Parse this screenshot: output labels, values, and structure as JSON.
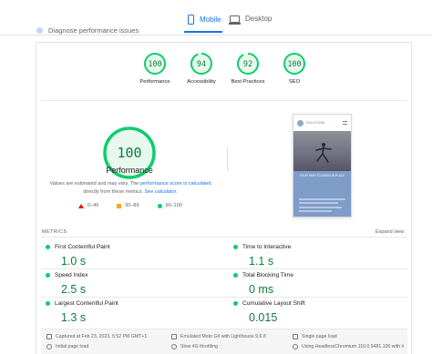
{
  "tabs": {
    "mobile": "Mobile",
    "desktop": "Desktop"
  },
  "diagnose_text": "Diagnose performance issues",
  "scores": [
    {
      "value": "100",
      "label": "Performance",
      "fraction": 1.0
    },
    {
      "value": "94",
      "label": "Accessibility",
      "fraction": 0.94
    },
    {
      "value": "92",
      "label": "Best Practices",
      "fraction": 0.92
    },
    {
      "value": "100",
      "label": "SEO",
      "fraction": 1.0
    }
  ],
  "main_score": {
    "value": "100",
    "title": "Performance",
    "fraction": 1.0
  },
  "note": {
    "prefix": "Values are estimated and may vary. The ",
    "link1": "performance score is calculated",
    "middle": " directly from these metrics. ",
    "link2": "See calculator."
  },
  "legend": [
    {
      "label": "0–49"
    },
    {
      "label": "50–89"
    },
    {
      "label": "90–100"
    }
  ],
  "thumbnail": {
    "brand": "SOLUTIONS",
    "hero_text": "YOUR PATH TO AGING IN PLACE",
    "photo_subject": "yoga pose"
  },
  "metrics_header": {
    "label": "METRICS",
    "expand": "Expand view"
  },
  "metrics": [
    {
      "name": "First Contentful Paint",
      "value": "1.0 s"
    },
    {
      "name": "Time to Interactive",
      "value": "1.1 s"
    },
    {
      "name": "Speed Index",
      "value": "2.5 s"
    },
    {
      "name": "Total Blocking Time",
      "value": "0 ms"
    },
    {
      "name": "Largest Contentful Paint",
      "value": "1.3 s"
    },
    {
      "name": "Cumulative Layout Shift",
      "value": "0.015"
    }
  ],
  "footer": {
    "captured": "Captured at Feb 23, 2023, 5:52 PM GMT+1",
    "initial_load": "Initial page load",
    "emulated": "Emulated Moto G4 with Lighthouse 9.6.8",
    "throttling": "Slow 4G throttling",
    "single_load": "Single page load",
    "browser": "Using HeadlessChromium 110.0.5481.100 with lr"
  },
  "colors": {
    "pass": "#0cce6b",
    "pass_text": "#0c7d3b",
    "pass_fill": "#e8f8ef",
    "tab_active": "#1a73e8"
  }
}
